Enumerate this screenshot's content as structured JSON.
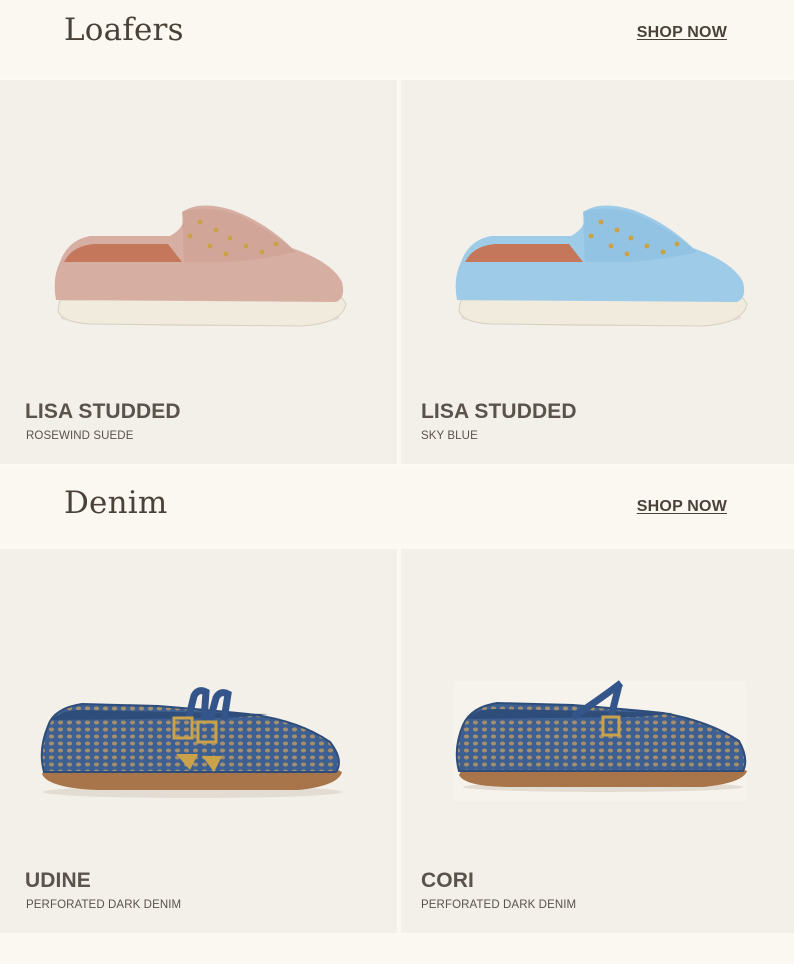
{
  "sections": [
    {
      "title": "Loafers",
      "cta": "SHOP NOW",
      "products": [
        {
          "name": "LISA STUDDED",
          "variant": "ROSEWIND SUEDE",
          "color": "#d7aea2",
          "image": "loafer-icon"
        },
        {
          "name": "LISA STUDDED",
          "variant": "SKY BLUE",
          "color": "#9dcbe8",
          "image": "loafer-icon"
        }
      ]
    },
    {
      "title": "Denim",
      "cta": "SHOP NOW",
      "products": [
        {
          "name": "UDINE",
          "variant": "PERFORATED DARK DENIM",
          "color": "#3d5f91",
          "image": "mary-jane-icon"
        },
        {
          "name": "CORI",
          "variant": "PERFORATED DARK DENIM",
          "color": "#3d5f91",
          "image": "mary-jane-icon"
        }
      ]
    }
  ]
}
